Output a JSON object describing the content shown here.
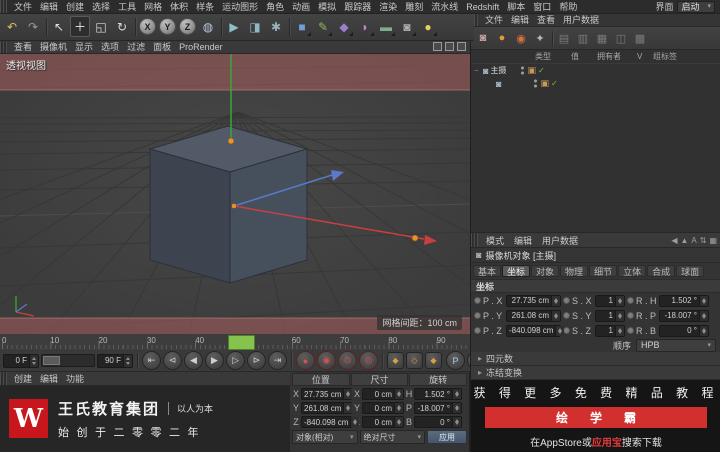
{
  "menubar": {
    "items": [
      "文件",
      "编辑",
      "创建",
      "选择",
      "工具",
      "网格",
      "体积",
      "样条",
      "运动图形",
      "角色",
      "动画",
      "模拟",
      "跟踪器",
      "渲染",
      "雕刻",
      "流水线",
      "Redshift",
      "脚本",
      "窗口",
      "帮助"
    ],
    "right_label": "界面",
    "right_value": "启动"
  },
  "toolbar": {
    "icons": [
      {
        "g": "↶",
        "c": "#d8c05a"
      },
      {
        "g": "↷",
        "c": "#9a9a9a"
      },
      {
        "sep": true
      },
      {
        "g": "↖",
        "c": "#e2e2e2"
      },
      {
        "g": "＋",
        "c": "#eaeaea",
        "active": true
      },
      {
        "g": "◱",
        "c": "#dcdcdc"
      },
      {
        "g": "↻",
        "c": "#dcdcdc"
      },
      {
        "sep": true
      },
      {
        "g": "X",
        "ball": true
      },
      {
        "g": "Y",
        "ball": true
      },
      {
        "g": "Z",
        "ball": true
      },
      {
        "g": "◍",
        "c": "#b8c8d8"
      },
      {
        "sep": true
      },
      {
        "g": "▶",
        "c": "#8fc0c8"
      },
      {
        "g": "◨",
        "c": "#8fb8c0"
      },
      {
        "g": "✱",
        "c": "#9ab0b8"
      },
      {
        "sep": true
      },
      {
        "g": "■",
        "c": "#6f9fd8",
        "more": true
      },
      {
        "g": "✎",
        "c": "#8fb85a",
        "more": true
      },
      {
        "g": "◆",
        "c": "#9a7fd0",
        "more": true
      },
      {
        "g": "◗",
        "c": "#c87fd0",
        "more": true
      },
      {
        "g": "▬",
        "c": "#7fae8f",
        "more": true
      },
      {
        "g": "◙",
        "c": "#b0b0b0",
        "more": true
      },
      {
        "g": "●",
        "c": "#e8d05a",
        "more": true
      }
    ]
  },
  "viewport": {
    "menu": [
      "查看",
      "摄像机",
      "显示",
      "选项",
      "过滤",
      "面板",
      "ProRender"
    ],
    "view_label": "透视视图",
    "grid_label": "网格间距：100 cm"
  },
  "timeline": {
    "ticks": [
      "0",
      "10",
      "20",
      "30",
      "40",
      "50",
      "60",
      "70",
      "80",
      "90"
    ]
  },
  "transport": {
    "start_frame": "0 F",
    "end_frame": "90 F",
    "current_frame": "0 F",
    "nav": [
      {
        "g": "⇤"
      },
      {
        "g": "⊲"
      },
      {
        "g": "◀"
      },
      {
        "g": "▶"
      },
      {
        "g": "▷"
      },
      {
        "g": "⊳"
      },
      {
        "g": "⇥"
      }
    ],
    "record": [
      {
        "g": "●"
      },
      {
        "g": "◉"
      },
      {
        "g": "⊙"
      },
      {
        "g": "◎"
      }
    ],
    "keys": [
      {
        "g": "◆"
      },
      {
        "g": "◇"
      },
      {
        "g": "◆"
      }
    ],
    "extras": [
      {
        "g": "P"
      },
      {
        "g": "▦"
      },
      {
        "g": "≣"
      }
    ]
  },
  "material_panel": {
    "menu": [
      "创建",
      "编辑",
      "功能"
    ]
  },
  "branding": {
    "logo_letter": "W",
    "company": "王氏教育集团",
    "slogan": "以人为本",
    "line2": "始创于二零零二年"
  },
  "coord_panel": {
    "headers": [
      "位置",
      "尺寸",
      "旋转"
    ],
    "rows": [
      {
        "pl": "X",
        "pv": "27.735 cm",
        "sl": "X",
        "sv": "0 cm",
        "rl": "H",
        "rv": "1.502 °"
      },
      {
        "pl": "Y",
        "pv": "261.08 cm",
        "sl": "Y",
        "sv": "0 cm",
        "rl": "P",
        "rv": "-18.007 °"
      },
      {
        "pl": "Z",
        "pv": "-840.098 cm",
        "sl": "Z",
        "sv": "0 cm",
        "rl": "B",
        "rv": "0 °"
      }
    ],
    "mode_dropdown": "对象(相对)",
    "size_dropdown": "绝对尺寸",
    "apply_label": "应用"
  },
  "object_panel": {
    "menu": [
      "文件",
      "编辑",
      "查看",
      "用户数据"
    ],
    "toolbar": [
      {
        "g": "◙",
        "c": "#c8a0a0"
      },
      {
        "g": "●",
        "c": "#e09a3a"
      },
      {
        "g": "◉",
        "c": "#e0703a"
      },
      {
        "g": "✦",
        "c": "#b8b8b8"
      },
      {
        "sep": true
      },
      {
        "g": "▤",
        "c": "#7a7a7a"
      },
      {
        "g": "▥",
        "c": "#7a7a7a"
      },
      {
        "g": "▦",
        "c": "#7a7a7a"
      },
      {
        "g": "◫",
        "c": "#7a7a7a"
      },
      {
        "g": "▩",
        "c": "#7a7a7a"
      }
    ],
    "columns": [
      "类型",
      "值",
      "拥有者",
      "V",
      "组标签"
    ],
    "rows": [
      {
        "name": "主摄",
        "indent": false
      },
      {
        "name": "",
        "indent": true
      }
    ]
  },
  "attribute_panel": {
    "tabs": [
      "模式",
      "编辑",
      "用户数据"
    ],
    "header_icons": [
      {
        "g": "◀"
      },
      {
        "g": "▲"
      },
      {
        "g": "A"
      },
      {
        "g": "⇅"
      },
      {
        "g": "▦"
      }
    ],
    "title": "摄像机对象 [主摄]",
    "chips": [
      {
        "label": "基本"
      },
      {
        "label": "坐标",
        "active": true
      },
      {
        "label": "对象"
      },
      {
        "label": "物理"
      },
      {
        "label": "细节"
      },
      {
        "label": "立体"
      },
      {
        "label": "合成"
      },
      {
        "label": "球面"
      }
    ],
    "section": "坐标",
    "fields": [
      {
        "l1": "P . X",
        "v1": "27.735 cm",
        "l2": "S . X",
        "v2": "1",
        "l3": "R . H",
        "v3": "1.502 °"
      },
      {
        "l1": "P . Y",
        "v1": "261.08 cm",
        "l2": "S . Y",
        "v2": "1",
        "l3": "R . P",
        "v3": "-18.007 °"
      },
      {
        "l1": "P . Z",
        "v1": "-840.098 cm",
        "l2": "S . Z",
        "v2": "1",
        "l3": "R . B",
        "v3": "0 °"
      }
    ],
    "order_label": "顺序",
    "order_value": "HPB",
    "sections_collapsed": [
      "四元数",
      "冻结变换"
    ]
  },
  "ad": {
    "line1": "获 得 更 多 免 费 精 品 教 程",
    "banner": "绘学霸",
    "line3_pre": "在AppStore或",
    "line3_hl": "应用宝",
    "line3_post": "搜索下载"
  },
  "colors": {
    "accent_orange": "#e8922e",
    "axis_red": "#c84040",
    "axis_green": "#3ba53b",
    "axis_blue": "#5b79c8",
    "playhead_green": "#85c34d",
    "brand_red": "#c8161d",
    "banner_red": "#d22f2f"
  }
}
